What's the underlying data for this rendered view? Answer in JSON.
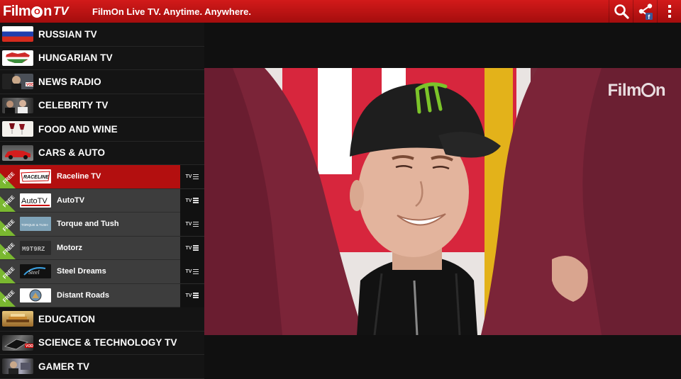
{
  "header": {
    "logo_main": "Film",
    "logo_o": "O",
    "logo_n": "n",
    "logo_tv": "TV",
    "tagline": "FilmOn Live TV. Anytime. Anywhere."
  },
  "sidebar": {
    "categories_top": [
      {
        "label": "RUSSIAN TV",
        "thumb": "russia-flag"
      },
      {
        "label": "HUNGARIAN TV",
        "thumb": "hungary-map"
      },
      {
        "label": "NEWS RADIO",
        "thumb": "news-radio"
      },
      {
        "label": "CELEBRITY TV",
        "thumb": "celebrity"
      },
      {
        "label": "FOOD AND WINE",
        "thumb": "food-wine"
      },
      {
        "label": "CARS & AUTO",
        "thumb": "cars-auto"
      }
    ],
    "channels": [
      {
        "name": "Raceline TV",
        "logo": "RACELINE",
        "free": "FREE",
        "tag": "TV",
        "active": true
      },
      {
        "name": "AutoTV",
        "logo": "AutoTV",
        "free": "FREE",
        "tag": "TV",
        "active": false
      },
      {
        "name": "Torque and Tush",
        "logo": "TORQUE & TUSH",
        "free": "FREE",
        "tag": "TV",
        "active": false
      },
      {
        "name": "Motorz",
        "logo": "M9T9RZ",
        "free": "FREE",
        "tag": "TV",
        "active": false
      },
      {
        "name": "Steel Dreams",
        "logo": "Steel",
        "free": "FREE",
        "tag": "TV",
        "active": false
      },
      {
        "name": "Distant Roads",
        "logo": "",
        "free": "FREE",
        "tag": "TV",
        "active": false
      }
    ],
    "categories_bottom": [
      {
        "label": "EDUCATION",
        "thumb": "education"
      },
      {
        "label": "SCIENCE & TECHNOLOGY TV",
        "thumb": "science-tech"
      },
      {
        "label": "GAMER TV",
        "thumb": "gamer"
      }
    ]
  },
  "player": {
    "watermark_left": "Film",
    "watermark_right": "n"
  },
  "colors": {
    "brand_red": "#c41414",
    "active_row": "#b30f0f",
    "free_badge": "#7ab830"
  }
}
